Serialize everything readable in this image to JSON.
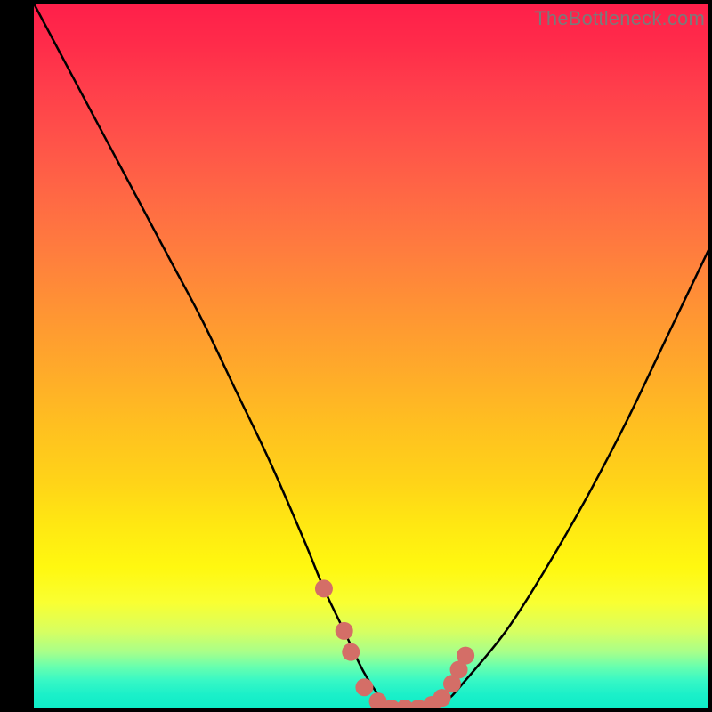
{
  "attribution": "TheBottleneck.com",
  "chart_data": {
    "type": "line",
    "title": "",
    "xlabel": "",
    "ylabel": "",
    "xlim": [
      0,
      100
    ],
    "ylim": [
      0,
      100
    ],
    "series": [
      {
        "name": "bottleneck-curve",
        "x": [
          0,
          5,
          10,
          15,
          20,
          25,
          30,
          35,
          40,
          43,
          46,
          49,
          52,
          55,
          58,
          61,
          64,
          70,
          76,
          82,
          88,
          94,
          100
        ],
        "values": [
          100,
          91,
          82,
          73,
          64,
          55,
          45,
          35,
          24,
          17,
          11,
          5,
          1,
          0,
          0,
          1,
          4,
          11,
          20,
          30,
          41,
          53,
          65
        ]
      }
    ],
    "markers": {
      "name": "highlight-dots",
      "color": "#d46e67",
      "points": [
        {
          "x": 43,
          "y": 17
        },
        {
          "x": 46,
          "y": 11
        },
        {
          "x": 47,
          "y": 8
        },
        {
          "x": 49,
          "y": 3
        },
        {
          "x": 51,
          "y": 1
        },
        {
          "x": 53,
          "y": 0
        },
        {
          "x": 55,
          "y": 0
        },
        {
          "x": 57,
          "y": 0
        },
        {
          "x": 59,
          "y": 0.5
        },
        {
          "x": 60.5,
          "y": 1.5
        },
        {
          "x": 62,
          "y": 3.5
        },
        {
          "x": 63,
          "y": 5.5
        },
        {
          "x": 64,
          "y": 7.5
        }
      ]
    }
  }
}
